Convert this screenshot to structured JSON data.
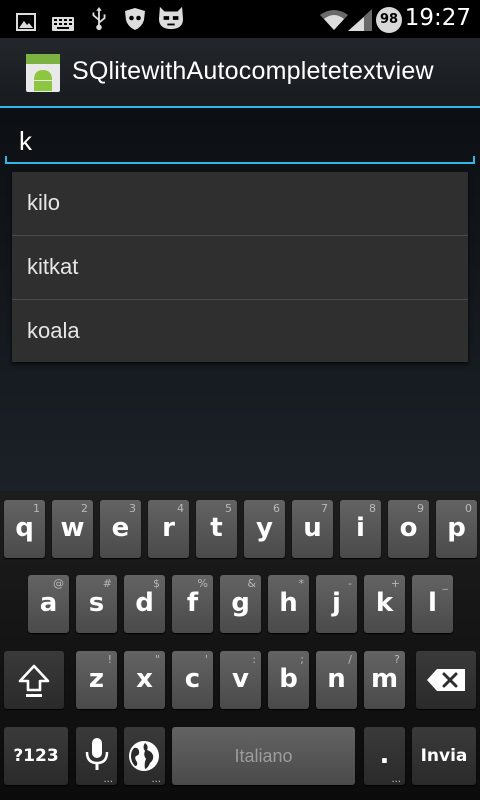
{
  "status_bar": {
    "time": "19:27",
    "battery_level": "98",
    "icons": [
      "image-icon",
      "keyboard-icon",
      "usb-icon",
      "shield-icon",
      "cyanogen-icon",
      "wifi-icon",
      "signal-icon"
    ]
  },
  "action_bar": {
    "app_icon": "android-app-icon",
    "title": "SQlitewithAutocompletetextview",
    "accent_color": "#33b5e5"
  },
  "search": {
    "value": "k"
  },
  "suggestions": [
    "kilo",
    "kitkat",
    "koala"
  ],
  "keyboard": {
    "row1": [
      {
        "key": "q",
        "hint": "1"
      },
      {
        "key": "w",
        "hint": "2"
      },
      {
        "key": "e",
        "hint": "3"
      },
      {
        "key": "r",
        "hint": "4"
      },
      {
        "key": "t",
        "hint": "5"
      },
      {
        "key": "y",
        "hint": "6"
      },
      {
        "key": "u",
        "hint": "7"
      },
      {
        "key": "i",
        "hint": "8"
      },
      {
        "key": "o",
        "hint": "9"
      },
      {
        "key": "p",
        "hint": "0"
      }
    ],
    "row2": [
      {
        "key": "a",
        "hint": "@"
      },
      {
        "key": "s",
        "hint": "#"
      },
      {
        "key": "d",
        "hint": "$"
      },
      {
        "key": "f",
        "hint": "%"
      },
      {
        "key": "g",
        "hint": "&"
      },
      {
        "key": "h",
        "hint": "*"
      },
      {
        "key": "j",
        "hint": "-"
      },
      {
        "key": "k",
        "hint": "+"
      },
      {
        "key": "l",
        "hint": "_"
      }
    ],
    "row3": [
      {
        "key": "z",
        "hint": "!"
      },
      {
        "key": "x",
        "hint": "\""
      },
      {
        "key": "c",
        "hint": "'"
      },
      {
        "key": "v",
        "hint": ":"
      },
      {
        "key": "b",
        "hint": ";"
      },
      {
        "key": "n",
        "hint": "/"
      },
      {
        "key": "m",
        "hint": "?"
      }
    ],
    "symbols_label": "?123",
    "space_label": "Italiano",
    "period_label": ".",
    "enter_label": "Invia"
  }
}
